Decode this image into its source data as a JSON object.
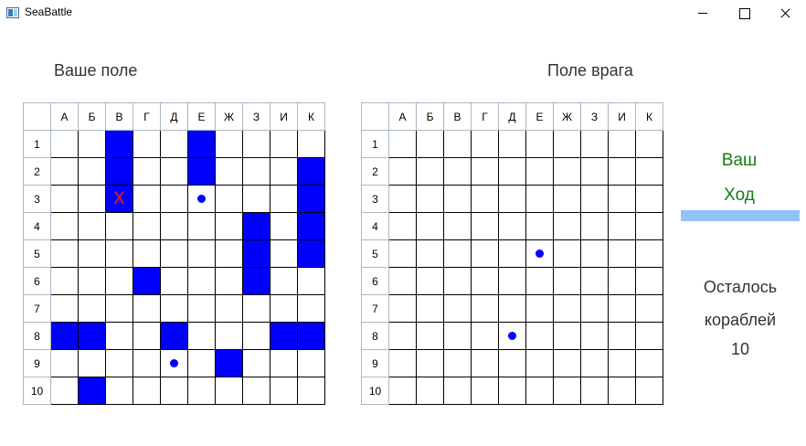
{
  "window": {
    "title": "SeaBattle",
    "controls": {
      "minimize": "minimize",
      "maximize": "maximize",
      "close": "close"
    }
  },
  "own_board": {
    "title": "Ваше поле",
    "columns": [
      "А",
      "Б",
      "В",
      "Г",
      "Д",
      "Е",
      "Ж",
      "З",
      "И",
      "К"
    ],
    "rows": [
      "1",
      "2",
      "3",
      "4",
      "5",
      "6",
      "7",
      "8",
      "9",
      "10"
    ],
    "ship_color": "#0000ff",
    "cells": [
      [
        "",
        "",
        "ship",
        "",
        "",
        "ship",
        "",
        "",
        "",
        ""
      ],
      [
        "",
        "",
        "ship",
        "",
        "",
        "ship",
        "",
        "",
        "",
        "ship"
      ],
      [
        "",
        "",
        "hit",
        "",
        "",
        "miss",
        "",
        "",
        "",
        "ship"
      ],
      [
        "",
        "",
        "",
        "",
        "",
        "",
        "",
        "ship",
        "",
        "ship"
      ],
      [
        "",
        "",
        "",
        "",
        "",
        "",
        "",
        "ship",
        "",
        "ship"
      ],
      [
        "",
        "",
        "",
        "ship",
        "",
        "",
        "",
        "ship",
        "",
        ""
      ],
      [
        "",
        "",
        "",
        "",
        "",
        "",
        "",
        "",
        "",
        ""
      ],
      [
        "ship",
        "ship",
        "",
        "",
        "ship",
        "",
        "",
        "",
        "ship",
        "ship"
      ],
      [
        "",
        "",
        "",
        "",
        "miss",
        "",
        "ship",
        "",
        "",
        ""
      ],
      [
        "",
        "ship",
        "",
        "",
        "",
        "",
        "",
        "",
        "",
        ""
      ]
    ],
    "hit_symbol": "X",
    "hit_color": "#ff1a1a"
  },
  "enemy_board": {
    "title": "Поле врага",
    "columns": [
      "А",
      "Б",
      "В",
      "Г",
      "Д",
      "Е",
      "Ж",
      "З",
      "И",
      "К"
    ],
    "rows": [
      "1",
      "2",
      "3",
      "4",
      "5",
      "6",
      "7",
      "8",
      "9",
      "10"
    ],
    "cells": [
      [
        "",
        "",
        "",
        "",
        "",
        "",
        "",
        "",
        "",
        ""
      ],
      [
        "",
        "",
        "",
        "",
        "",
        "",
        "",
        "",
        "",
        ""
      ],
      [
        "",
        "",
        "",
        "",
        "",
        "",
        "",
        "",
        "",
        ""
      ],
      [
        "",
        "",
        "",
        "",
        "",
        "",
        "",
        "",
        "",
        ""
      ],
      [
        "",
        "",
        "",
        "",
        "",
        "miss",
        "",
        "",
        "",
        ""
      ],
      [
        "",
        "",
        "",
        "",
        "",
        "",
        "",
        "",
        "",
        ""
      ],
      [
        "",
        "",
        "",
        "",
        "",
        "",
        "",
        "",
        "",
        ""
      ],
      [
        "",
        "",
        "",
        "",
        "miss",
        "",
        "",
        "",
        "",
        ""
      ],
      [
        "",
        "",
        "",
        "",
        "",
        "",
        "",
        "",
        "",
        ""
      ],
      [
        "",
        "",
        "",
        "",
        "",
        "",
        "",
        "",
        "",
        ""
      ]
    ]
  },
  "status": {
    "turn_line1": "Ваш",
    "turn_line2": "Ход",
    "turn_color": "#167c16",
    "turn_bar_color": "#90c4f7",
    "ships_left_line1": "Осталось",
    "ships_left_line2": "кораблей",
    "ships_left_count": "10"
  }
}
